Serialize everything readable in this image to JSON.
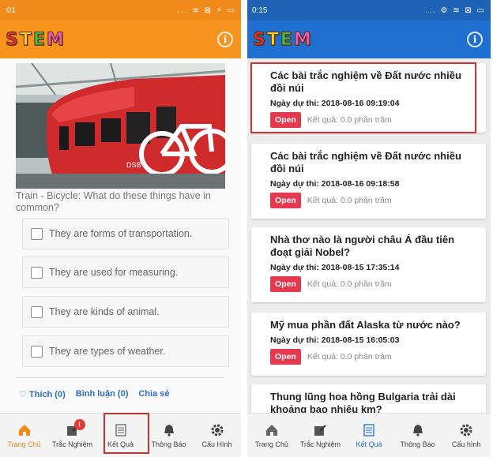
{
  "left": {
    "status": {
      "time": ":01",
      "icons": "... ≋ ⊠ ⚡ ▭"
    },
    "logo": [
      "S",
      "T",
      "E",
      "M"
    ],
    "question": "Train - Bicycle: What do these things have in common?",
    "options": [
      "They are forms of transportation.",
      "They are used for measuring.",
      "They are kinds of animal.",
      "They are types of weather."
    ],
    "social": {
      "like": "♡ Thích (0)",
      "comment": "Bình luận (0)",
      "share": "Chia sẻ"
    },
    "nav": [
      {
        "label": "Trang Chủ",
        "icon": "home-icon"
      },
      {
        "label": "Trắc Nghiệm",
        "icon": "quiz-icon",
        "badge": "!"
      },
      {
        "label": "Kết Quả",
        "icon": "results-icon"
      },
      {
        "label": "Thông Báo",
        "icon": "bell-icon"
      },
      {
        "label": "Cấu Hình",
        "icon": "gear-icon"
      }
    ]
  },
  "right": {
    "status": {
      "time": "0:15",
      "icons": "... ⚙ ≋ ⊠ ▭"
    },
    "logo": [
      "S",
      "T",
      "E",
      "M"
    ],
    "date_label": "Ngày dự thi:",
    "open_label": "Open",
    "cards": [
      {
        "title": "Các bài trắc nghiệm về Đất nước nhiều đồi núi",
        "date": "2018-08-16 09:19:04",
        "result": "Kết quả: 0.0 phần trăm"
      },
      {
        "title": "Các bài trắc nghiệm về Đất nước nhiều đồi núi",
        "date": "2018-08-16 09:18:58",
        "result": "Kết quả: 0.0 phần trăm"
      },
      {
        "title": "Nhà thơ nào là người châu Á đầu tiên đoạt giải Nobel?",
        "date": "2018-08-15 17:35:14",
        "result": "Kết quả: 0.0 phần trăm"
      },
      {
        "title": "Mỹ mua phần đất Alaska từ nước nào?",
        "date": "2018-08-15 16:05:03",
        "result": "Kết quả: 0.0 phần trăm"
      },
      {
        "title": "Thung lũng hoa hồng Bulgaria trải dài khoảng bao nhiêu km?"
      }
    ],
    "nav": [
      {
        "label": "Trang Chủ",
        "icon": "home-icon"
      },
      {
        "label": "Trắc Nghiệm",
        "icon": "quiz-icon"
      },
      {
        "label": "Kết Quả",
        "icon": "results-icon"
      },
      {
        "label": "Thông Báo",
        "icon": "bell-icon"
      },
      {
        "label": "Cấu hình",
        "icon": "gear-icon"
      }
    ]
  },
  "colors": {
    "orange": "#f7941d",
    "blue": "#1f6fd1",
    "open_red": "#e53950",
    "highlight_red": "#d32f2f"
  }
}
